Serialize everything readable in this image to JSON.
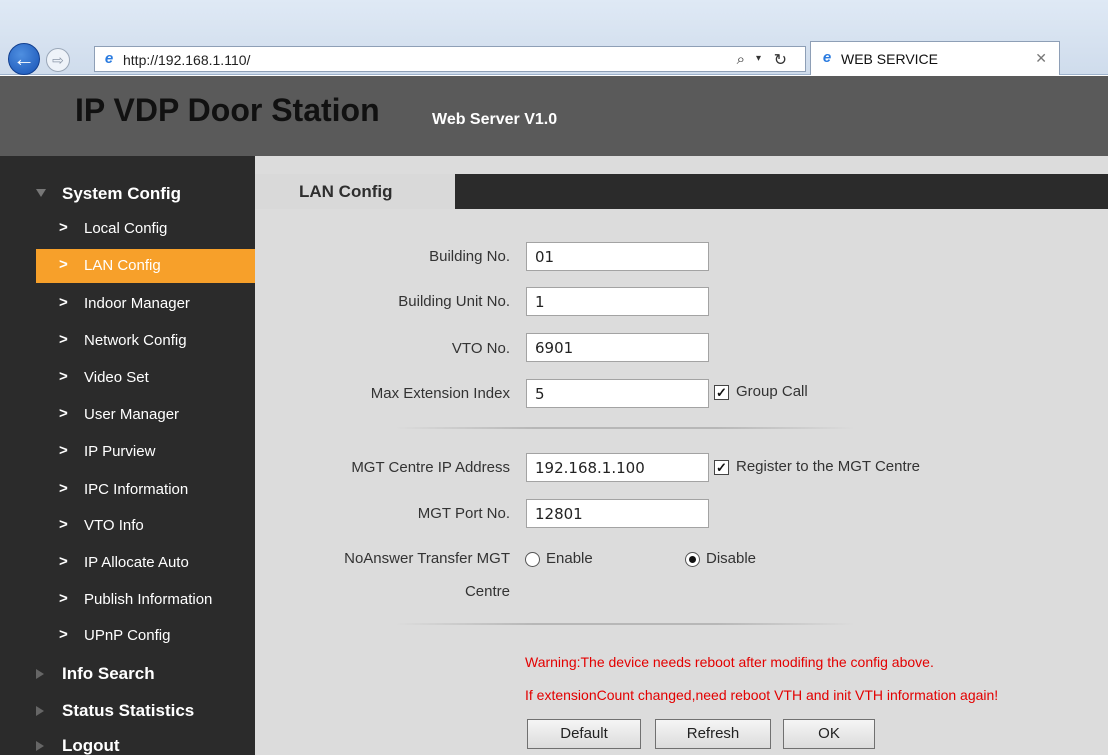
{
  "browser": {
    "url": "http://192.168.1.110/",
    "tab_title": "WEB SERVICE",
    "icons": [
      "back-arrow-icon",
      "forward-arrow-icon",
      "ie-icon",
      "search-icon",
      "refresh-icon",
      "close-icon"
    ]
  },
  "header": {
    "title": "IP VDP Door Station",
    "version": "Web Server V1.0"
  },
  "sidebar": {
    "sections": [
      {
        "label": "System Config",
        "expanded": true
      },
      {
        "label": "Info Search",
        "expanded": false
      },
      {
        "label": "Status Statistics",
        "expanded": false
      },
      {
        "label": "Logout",
        "expanded": false
      }
    ],
    "items": [
      {
        "label": "Local Config"
      },
      {
        "label": "LAN Config",
        "active": true
      },
      {
        "label": "Indoor Manager"
      },
      {
        "label": "Network Config"
      },
      {
        "label": "Video Set"
      },
      {
        "label": "User Manager"
      },
      {
        "label": "IP Purview"
      },
      {
        "label": "IPC Information"
      },
      {
        "label": "VTO Info"
      },
      {
        "label": "IP Allocate Auto"
      },
      {
        "label": "Publish Information"
      },
      {
        "label": "UPnP Config"
      }
    ],
    "active_color": "#f7a02a"
  },
  "main": {
    "tab_label": "LAN Config",
    "fields": {
      "building_no": {
        "label": "Building No.",
        "value": "01"
      },
      "building_unit_no": {
        "label": "Building Unit No.",
        "value": "1"
      },
      "vto_no": {
        "label": "VTO No.",
        "value": "6901"
      },
      "max_extension_index": {
        "label": "Max Extension Index",
        "value": "5"
      },
      "mgt_centre_ip": {
        "label": "MGT Centre IP Address",
        "value": "192.168.1.100"
      },
      "mgt_port_no": {
        "label": "MGT Port No.",
        "value": "12801"
      }
    },
    "group_call": {
      "label": "Group Call",
      "checked": true
    },
    "register_mgt": {
      "label": "Register to the MGT Centre",
      "checked": true
    },
    "noanswer_transfer": {
      "label_line1": "NoAnswer Transfer MGT",
      "label_line2": "Centre",
      "enable_label": "Enable",
      "disable_label": "Disable",
      "selected": "Disable"
    },
    "warnings": {
      "line1": "Warning:The device needs reboot after modifing the config above.",
      "line2": "If extensionCount changed,need reboot VTH and init VTH information again!"
    },
    "buttons": {
      "default": "Default",
      "refresh": "Refresh",
      "ok": "OK"
    },
    "warning_color": "#e30000"
  }
}
